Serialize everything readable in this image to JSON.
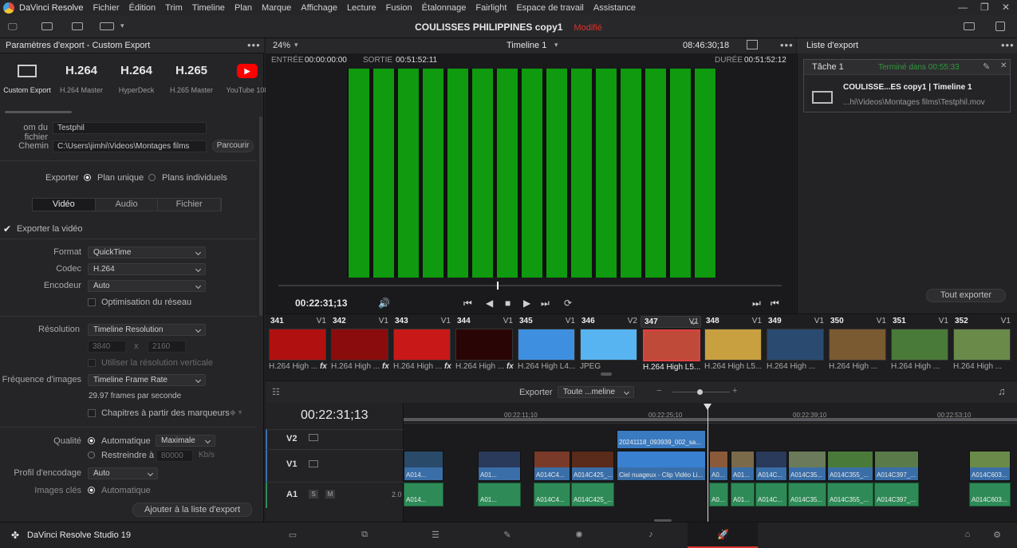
{
  "menubar": {
    "app": "DaVinci Resolve",
    "items": [
      "Fichier",
      "Édition",
      "Trim",
      "Timeline",
      "Plan",
      "Marque",
      "Affichage",
      "Lecture",
      "Fusion",
      "Étalonnage",
      "Fairlight",
      "Espace de travail",
      "Assistance"
    ]
  },
  "project": {
    "title": "COULISSES PHILIPPINES copy1",
    "status": "Modifié"
  },
  "left": {
    "header": "Paramètres d'export - Custom Export",
    "presets": [
      {
        "big": "",
        "label": "Custom Export"
      },
      {
        "big": "H.264",
        "label": "H.264 Master"
      },
      {
        "big": "H.264",
        "label": "HyperDeck"
      },
      {
        "big": "H.265",
        "label": "H.265 Master"
      },
      {
        "big": "",
        "label": "YouTube 108"
      }
    ],
    "filename_label": "om du fichier",
    "filename": "Testphil",
    "path_label": "Chemin",
    "path": "C:\\Users\\jimhi\\Videos\\Montages films",
    "browse": "Parcourir",
    "export_label": "Exporter",
    "single_clip": "Plan unique",
    "individual_clips": "Plans individuels",
    "tabs": [
      "Vidéo",
      "Audio",
      "Fichier"
    ],
    "export_video": "Exporter la vidéo",
    "format_label": "Format",
    "format": "QuickTime",
    "codec_label": "Codec",
    "codec": "H.264",
    "encoder_label": "Encodeur",
    "encoder": "Auto",
    "network_opt": "Optimisation du réseau",
    "resolution_label": "Résolution",
    "resolution": "Timeline Resolution",
    "width": "3840",
    "x": "x",
    "height": "2160",
    "vertical_res": "Utiliser la résolution verticale",
    "framerate_label": "Fréquence d'images",
    "framerate": "Timeline Frame Rate",
    "fps_text": "29.97 frames par seconde",
    "chapters": "Chapitres à partir des marqueurs",
    "quality_label": "Qualité",
    "quality_auto": "Automatique",
    "quality_value": "Maximale",
    "restrict": "Restreindre à",
    "restrict_value": "80000",
    "kbs": "Kb/s",
    "profile_label": "Profil d'encodage",
    "profile": "Auto",
    "keyframes_label": "Images clés",
    "keyframes": "Automatique",
    "add_button": "Ajouter à la liste d'export"
  },
  "viewer": {
    "zoom": "24%",
    "timeline": "Timeline 1",
    "timecode_top": "08:46:30;18",
    "in_label": "ENTRÉE",
    "in_tc": "00:00:00:00",
    "out_label": "SORTIE",
    "out_tc": "00:51:52:11",
    "dur_label": "DURÉE",
    "dur_tc": "00:51:52:12",
    "current_tc": "00:22:31;13",
    "scrub_position": 0.435
  },
  "export_list": {
    "header": "Liste d'export",
    "job_title": "Tâche 1",
    "job_status": "Terminé dans 00:55:33",
    "job_name": "COULISSE...ES copy1 | Timeline 1",
    "job_path": "...hi\\Videos\\Montages films\\Testphil.mov",
    "export_all": "Tout exporter"
  },
  "thumbs": [
    {
      "num": "341",
      "trk": "V1",
      "cap": "H.264 High ...",
      "color": "#b01010",
      "fx": "fx"
    },
    {
      "num": "342",
      "trk": "V1",
      "cap": "H.264 High ...",
      "color": "#8a0c0c",
      "fx": "fx"
    },
    {
      "num": "343",
      "trk": "V1",
      "cap": "H.264 High ...",
      "color": "#c81818",
      "fx": "fx"
    },
    {
      "num": "344",
      "trk": "V1",
      "cap": "H.264 High ...",
      "color": "#2a0505",
      "fx": "fx"
    },
    {
      "num": "345",
      "trk": "V1",
      "cap": "H.264 High L4...",
      "color": "#3f8fe0",
      "fx": ""
    },
    {
      "num": "346",
      "trk": "V2",
      "cap": "JPEG",
      "color": "#58b4f0",
      "fx": ""
    },
    {
      "num": "347",
      "trk": "V1",
      "cap": "H.264 High L5...",
      "color": "#c04a3a",
      "fx": ""
    },
    {
      "num": "348",
      "trk": "V1",
      "cap": "H.264 High L5...",
      "color": "#c8a040",
      "fx": ""
    },
    {
      "num": "349",
      "trk": "V1",
      "cap": "H.264 High ...",
      "color": "#2a4a70",
      "fx": ""
    },
    {
      "num": "350",
      "trk": "V1",
      "cap": "H.264 High ...",
      "color": "#7a5a30",
      "fx": ""
    },
    {
      "num": "351",
      "trk": "V1",
      "cap": "H.264 High ...",
      "color": "#4a7a3a",
      "fx": ""
    },
    {
      "num": "352",
      "trk": "V1",
      "cap": "H.264 High ...",
      "color": "#6a8a4a",
      "fx": ""
    }
  ],
  "timeline": {
    "export_label": "Exporter",
    "export_range": "Toute ...meline",
    "timecode": "00:22:31;13",
    "ticks": [
      "00:22:11;10",
      "00:22:25;10",
      "00:22:39;10",
      "00:22:53;10"
    ],
    "tracks": {
      "v2": "V2",
      "v1": "V1",
      "a1": "A1",
      "a1_s": "S",
      "a1_m": "M",
      "a1_level": "2.0"
    },
    "v2_clip": "20241118_093939_002_sa...",
    "v1_clips": [
      "A014...",
      "A01...",
      "A014C4...",
      "A014C425_...",
      "Ciel nuageux - Clip Vidéo Li...",
      "A0...",
      "A01...",
      "A014C...",
      "A014C35...",
      "A014C355_...",
      "A014C397_...",
      "A014C603..."
    ],
    "a1_clips": [
      "A014...",
      "A01...",
      "A014C4...",
      "A014C425_...",
      "A0...",
      "A01...",
      "A014C...",
      "A014C35...",
      "A014C355_...",
      "A014C397_...",
      "A014C603..."
    ]
  },
  "bottom": {
    "brand": "DaVinci Resolve Studio 19"
  }
}
